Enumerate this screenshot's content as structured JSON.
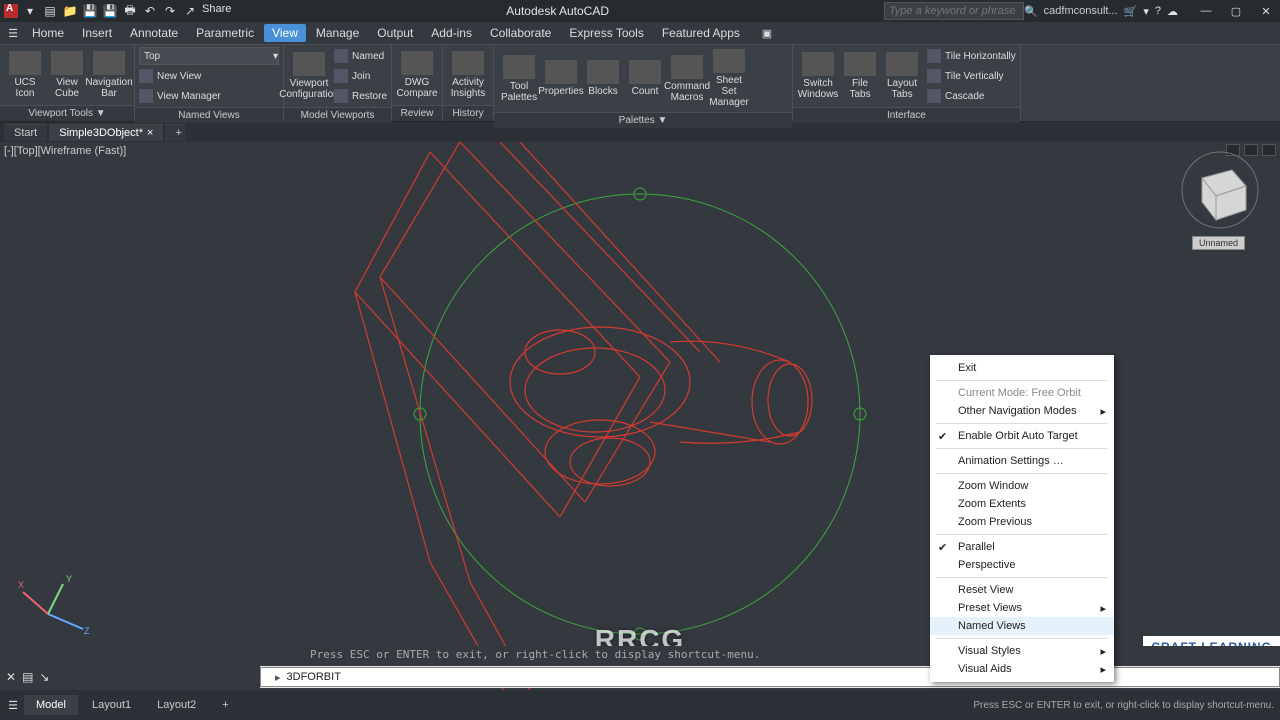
{
  "title": "Autodesk AutoCAD",
  "search_placeholder": "Type a keyword or phrase",
  "user_label": "cadfmconsult...",
  "qat": {
    "share": "Share"
  },
  "menu": {
    "items": [
      "Home",
      "Insert",
      "Annotate",
      "Parametric",
      "View",
      "Manage",
      "Output",
      "Add-ins",
      "Collaborate",
      "Express Tools",
      "Featured Apps"
    ],
    "active_index": 4
  },
  "ribbon": {
    "panels": [
      {
        "title": "Viewport Tools ▼",
        "big": [
          {
            "label": "UCS Icon"
          },
          {
            "label": "View Cube"
          },
          {
            "label": "Navigation Bar"
          }
        ]
      },
      {
        "title": "Named Views",
        "top_dropdown": "Top",
        "small": [
          "New View",
          "View Manager"
        ],
        "big": []
      },
      {
        "title": "Model Viewports",
        "big": [
          {
            "label": "Viewport Configuration"
          }
        ],
        "small": [
          "Named",
          "Join",
          "Restore"
        ]
      },
      {
        "title": "Review",
        "big": [
          {
            "label": "DWG Compare"
          }
        ]
      },
      {
        "title": "History",
        "big": [
          {
            "label": "Activity Insights"
          }
        ]
      },
      {
        "title": "Palettes ▼",
        "big": [
          {
            "label": "Tool Palettes"
          },
          {
            "label": "Properties"
          },
          {
            "label": "Blocks"
          },
          {
            "label": "Count"
          },
          {
            "label": "Command Macros"
          },
          {
            "label": "Sheet Set Manager"
          }
        ],
        "grid": true
      },
      {
        "title": "Interface",
        "big": [
          {
            "label": "Switch Windows"
          },
          {
            "label": "File Tabs"
          },
          {
            "label": "Layout Tabs"
          }
        ],
        "small": [
          "Tile Horizontally",
          "Tile Vertically",
          "Cascade"
        ]
      }
    ]
  },
  "doctabs": {
    "items": [
      "Start",
      "Simple3DObject*"
    ],
    "active_index": 1
  },
  "viewport_label": "[-][Top][Wireframe (Fast)]",
  "viewcube_label": "Unnamed",
  "context_menu": {
    "items": [
      {
        "label": "Exit"
      },
      {
        "sep": true
      },
      {
        "label": "Current Mode: Free Orbit",
        "disabled": true
      },
      {
        "label": "Other Navigation Modes",
        "sub": true
      },
      {
        "sep": true
      },
      {
        "label": "Enable Orbit Auto Target",
        "checked": true
      },
      {
        "sep": true
      },
      {
        "label": "Animation Settings …"
      },
      {
        "sep": true
      },
      {
        "label": "Zoom Window"
      },
      {
        "label": "Zoom Extents"
      },
      {
        "label": "Zoom Previous"
      },
      {
        "sep": true
      },
      {
        "label": "Parallel",
        "checked": true
      },
      {
        "label": "Perspective"
      },
      {
        "sep": true
      },
      {
        "label": "Reset View"
      },
      {
        "label": "Preset Views",
        "sub": true
      },
      {
        "label": "Named Views",
        "hover": true
      },
      {
        "sep": true
      },
      {
        "label": "Visual Styles",
        "sub": true
      },
      {
        "label": "Visual Aids",
        "sub": true
      }
    ]
  },
  "cmd_history": "Press ESC or ENTER to exit, or right-click to display shortcut-menu.",
  "cmd_input": "3DFORBIT",
  "layout_tabs": {
    "items": [
      "Model",
      "Layout1",
      "Layout2"
    ],
    "active_index": 0
  },
  "status_help": "Press ESC or ENTER to exit, or right-click to display shortcut-menu.",
  "watermark": "RRCG",
  "craft_badge": "CRAFT LEARNING"
}
